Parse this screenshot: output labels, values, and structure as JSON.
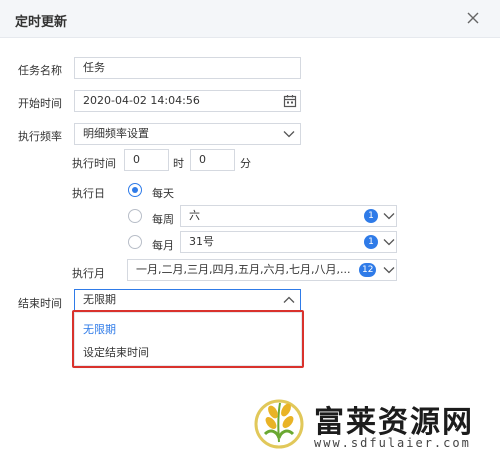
{
  "dialog": {
    "title": "定时更新"
  },
  "form": {
    "task_name": {
      "label": "任务名称",
      "value": "任务"
    },
    "start_time": {
      "label": "开始时间",
      "value": "2020-04-02 14:04:56"
    },
    "frequency": {
      "label": "执行频率",
      "value": "明细频率设置"
    },
    "exec_time": {
      "label": "执行时间",
      "hour": "0",
      "hour_unit": "时",
      "minute": "0",
      "minute_unit": "分"
    },
    "exec_day": {
      "label": "执行日",
      "daily": "每天",
      "weekly": {
        "label": "每周",
        "value": "六",
        "count": "1"
      },
      "monthly": {
        "label": "每月",
        "value": "31号",
        "count": "1"
      }
    },
    "exec_month": {
      "label": "执行月",
      "value": "一月,二月,三月,四月,五月,六月,七月,八月,...",
      "count": "12"
    },
    "end_time": {
      "label": "结束时间",
      "value": "无限期"
    }
  },
  "dropdown": {
    "options": [
      "无限期",
      "设定结束时间"
    ]
  },
  "watermark": {
    "brand": "富莱资源网",
    "url": "www.sdfulaier.com"
  },
  "colors": {
    "accent": "#2f7be8",
    "highlight": "#d9322c",
    "header_bg": "#f4f6f9"
  }
}
